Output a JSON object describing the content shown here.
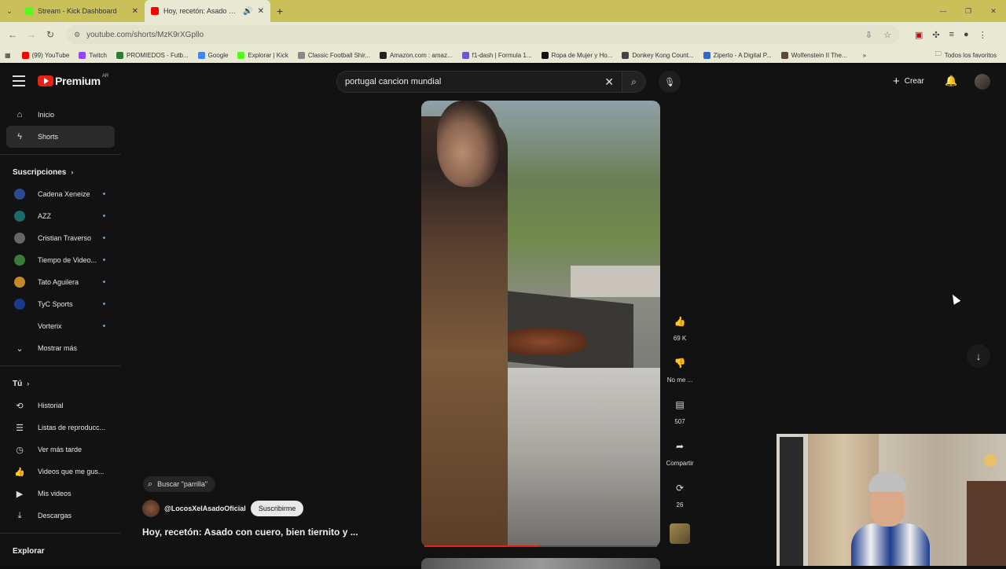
{
  "browser": {
    "tabs": [
      {
        "title": "Stream - Kick Dashboard",
        "color": "#53fc18",
        "active": false
      },
      {
        "title": "Hoy, recetón: Asado con cu...",
        "color": "#ff0000",
        "active": true
      }
    ],
    "url": "youtube.com/shorts/MzK9rXGpllo",
    "bookmarks": [
      {
        "label": "(99) YouTube",
        "color": "#ff0000"
      },
      {
        "label": "Twitch",
        "color": "#9146ff"
      },
      {
        "label": "PROMIEDOS - Futb...",
        "color": "#2e7d32"
      },
      {
        "label": "Google",
        "color": "#4285f4"
      },
      {
        "label": "Explorar | Kick",
        "color": "#53fc18"
      },
      {
        "label": "Classic Football Shir...",
        "color": "#888888"
      },
      {
        "label": "Amazon.com : amaz...",
        "color": "#222222"
      },
      {
        "label": "f1-dash | Formula 1...",
        "color": "#6a5acd"
      },
      {
        "label": "Ropa de Mujer y Ho...",
        "color": "#111111"
      },
      {
        "label": "Donkey Kong Count...",
        "color": "#444444"
      },
      {
        "label": "Ziperto - A Digital P...",
        "color": "#3366cc"
      },
      {
        "label": "Wolfenstein II The...",
        "color": "#5a4a3a"
      }
    ],
    "bookmarks_all": "Todos los favoritos"
  },
  "youtube": {
    "brand": "Premium",
    "country": "AR",
    "search_value": "portugal cancion mundial",
    "create_label": "Crear",
    "sidebar": {
      "main": [
        {
          "label": "Inicio",
          "icon": "home-icon"
        },
        {
          "label": "Shorts",
          "icon": "shorts-icon",
          "active": true
        }
      ],
      "subs_header": "Suscripciones",
      "subs": [
        {
          "label": "Cadena Xeneize",
          "color": "#2b4a8f"
        },
        {
          "label": "AZZ",
          "color": "#1b6b6b"
        },
        {
          "label": "Cristian Traverso",
          "color": "#666666"
        },
        {
          "label": "Tiempo de Video...",
          "color": "#3a7a3a"
        },
        {
          "label": "Tato Aguilera",
          "color": "#c28a2a"
        },
        {
          "label": "TyC Sports",
          "color": "#1a3a8a"
        },
        {
          "label": "Vorterix",
          "color": "#111111"
        }
      ],
      "show_more": "Mostrar más",
      "you_header": "Tú",
      "you": [
        {
          "label": "Historial",
          "icon": "history-icon"
        },
        {
          "label": "Listas de reproducc...",
          "icon": "playlist-icon"
        },
        {
          "label": "Ver más tarde",
          "icon": "clock-icon"
        },
        {
          "label": "Videos que me gus...",
          "icon": "like-icon"
        },
        {
          "label": "Mis videos",
          "icon": "video-icon"
        },
        {
          "label": "Descargas",
          "icon": "download-icon"
        }
      ],
      "explore_header": "Explorar"
    },
    "short": {
      "search_chip": "Buscar \"parrilla\"",
      "channel": "@LocosXelAsadoOficial",
      "subscribe": "Suscribirme",
      "title": "Hoy, recetón: Asado con cuero, bien tiernito y ...",
      "progress": 0.49,
      "likes": "69 K",
      "dislike": "No me ...",
      "comments": "507",
      "share": "Compartir",
      "remix": "26"
    }
  }
}
